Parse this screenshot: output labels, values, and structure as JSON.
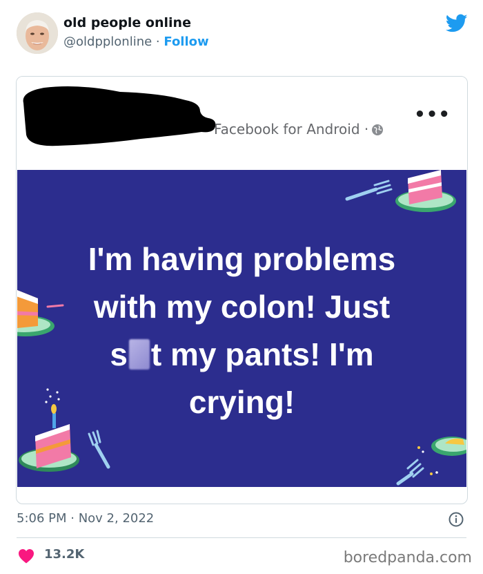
{
  "author": {
    "name": "old people online",
    "handle": "@oldpplonline",
    "separator": " · ",
    "follow_label": "Follow"
  },
  "post_card": {
    "source_label": "Facebook for Android ·",
    "more_label": "•••",
    "text_lines": {
      "line1": "I'm having problems",
      "line2": "with my colon! Just",
      "line3_start": "s",
      "line3_end": "t my pants! I'm",
      "line4": "crying!"
    }
  },
  "footer": {
    "timestamp": "5:06 PM · Nov 2, 2022",
    "like_count": "13.2K",
    "watermark": "boredpanda.com"
  },
  "colors": {
    "accent": "#1d9bf0",
    "post_background": "#2c2d8e",
    "like": "#f91880"
  },
  "icons": {
    "brand": "twitter-bird-icon",
    "info": "info-icon",
    "like": "heart-icon",
    "privacy": "globe-icon"
  }
}
